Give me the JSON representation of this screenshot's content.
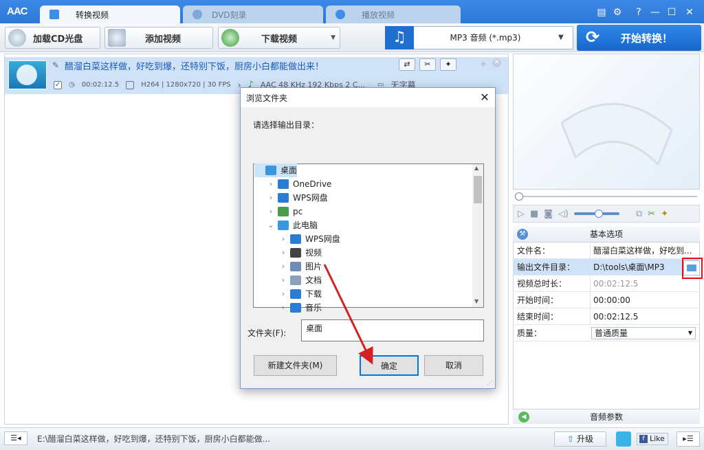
{
  "app": {
    "logo": "AAC",
    "tabs": [
      {
        "label": "转换视频",
        "active": true
      },
      {
        "label": "DVD刻录",
        "active": false
      },
      {
        "label": "播放视频",
        "active": false
      }
    ],
    "window_controls": {
      "help": "?",
      "minimize": "—",
      "maximize": "☐",
      "close": "✕"
    }
  },
  "toolbar": {
    "load_cd": "加载CD光盘",
    "add_video": "添加视频",
    "download_video": "下载视频",
    "format_label": "MP3 音频 (*.mp3)",
    "start": "开始转换！"
  },
  "file_item": {
    "name": "醋溜白菜这样做，好吃到爆，还特别下饭，厨房小白都能做出来！",
    "duration": "00:02:12.5",
    "video_info": "H264 | 1280x720 | 30 FPS",
    "audio_info": "AAC 48 KHz 192 Kbps 2 C...",
    "subtitle": "无字幕"
  },
  "properties": {
    "header": "基本选项",
    "rows": [
      {
        "key": "文件名：",
        "value": "醋溜白菜这样做，好吃到..."
      },
      {
        "key": "输出文件目录：",
        "value": "D:\\tools\\桌面\\MP3"
      },
      {
        "key": "视频总时长：",
        "value": "00:02:12.5"
      },
      {
        "key": "开始时间：",
        "value": "00:00:00"
      },
      {
        "key": "结束时间：",
        "value": "00:02:12.5"
      },
      {
        "key": "质量：",
        "value": "普通质量"
      }
    ],
    "audio_header": "音频参数"
  },
  "status": {
    "path": "E:\\醋溜白菜这样做，好吃到爆，还特别下饭，厨房小白都能做...",
    "upgrade": "升级",
    "like": "Like"
  },
  "dialog": {
    "title": "浏览文件夹",
    "prompt": "请选择输出目录：",
    "tree": [
      {
        "label": "桌面",
        "level": 0,
        "selected": true,
        "chevron": ""
      },
      {
        "label": "OneDrive",
        "level": 1,
        "chevron": ">"
      },
      {
        "label": "WPS网盘",
        "level": 1,
        "chevron": ">"
      },
      {
        "label": "pc",
        "level": 1,
        "chevron": ">"
      },
      {
        "label": "此电脑",
        "level": 1,
        "chevron": "v"
      },
      {
        "label": "WPS网盘",
        "level": 2,
        "chevron": ">"
      },
      {
        "label": "视频",
        "level": 2,
        "chevron": ">"
      },
      {
        "label": "图片",
        "level": 2,
        "chevron": ">"
      },
      {
        "label": "文档",
        "level": 2,
        "chevron": ">"
      },
      {
        "label": "下载",
        "level": 2,
        "chevron": ">"
      },
      {
        "label": "音乐",
        "level": 2,
        "chevron": ">"
      }
    ],
    "folder_label": "文件夹(F):",
    "folder_value": "桌面",
    "new_folder": "新建文件夹(M)",
    "ok": "确定",
    "cancel": "取消"
  },
  "colors": {
    "accent": "#2d77d8",
    "highlight": "#e01010",
    "arrow": "#d42020"
  }
}
